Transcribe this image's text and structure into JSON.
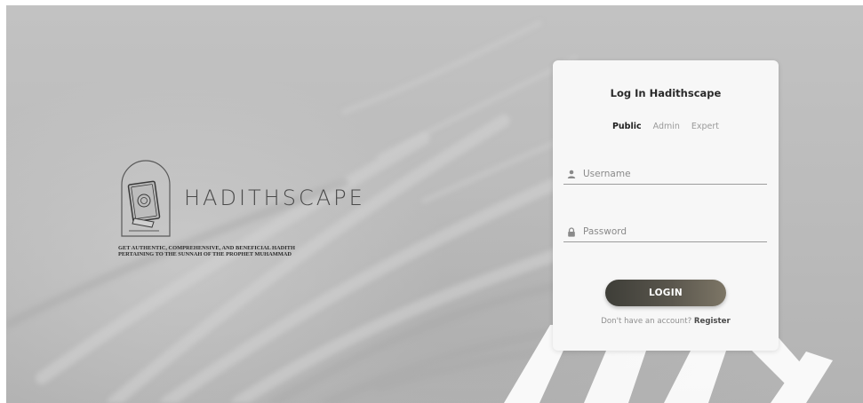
{
  "brand": {
    "name": "HADITHSCAPE",
    "tagline_line1": "GET AUTHENTIC, COMPREHENSIVE, AND BENEFICIAL HADITH",
    "tagline_line2": "PERTAINING TO THE SUNNAH OF THE PROPHET MUHAMMAD",
    "logo_icon": "quran-book-icon"
  },
  "login_card": {
    "title": "Log In Hadithscape",
    "tabs": [
      {
        "label": "Public",
        "active": true
      },
      {
        "label": "Admin",
        "active": false
      },
      {
        "label": "Expert",
        "active": false
      }
    ],
    "username": {
      "placeholder": "Username",
      "value": "",
      "icon": "user-icon"
    },
    "password": {
      "placeholder": "Password",
      "value": "",
      "icon": "lock-icon"
    },
    "login_label": "LOGIN",
    "register_prompt": "Don't have an account?",
    "register_label": "Register"
  },
  "colors": {
    "background": "#bdbdbd",
    "card": "#f7f7f7",
    "button_dark": "#3e3e38",
    "button_light": "#7d7666",
    "text_dark": "#2a2a2a",
    "text_muted": "#8f8f8f"
  }
}
